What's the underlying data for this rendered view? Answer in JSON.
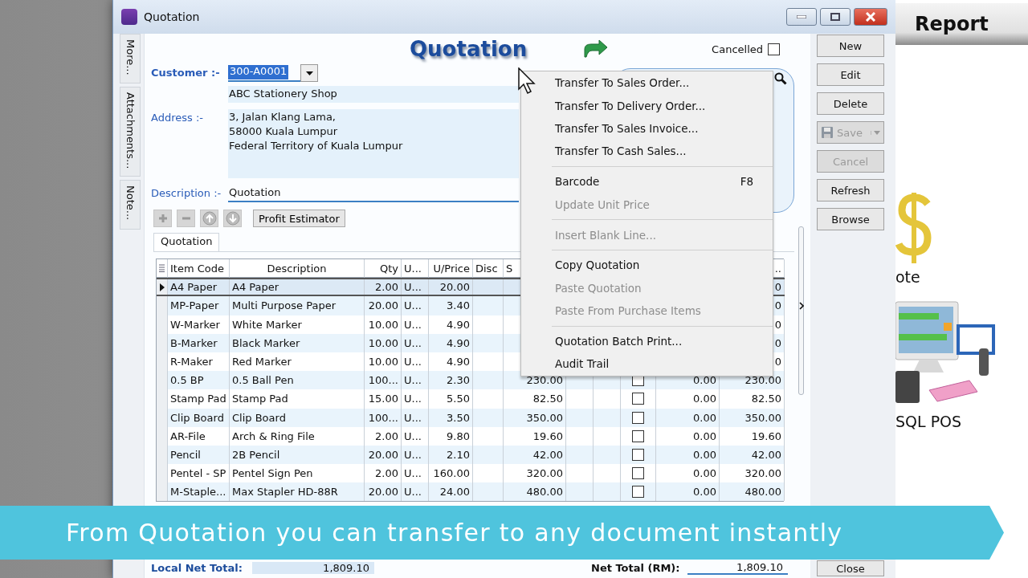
{
  "window": {
    "title": "Quotation"
  },
  "side_tabs": [
    {
      "label": "More..."
    },
    {
      "label": "Attachments..."
    },
    {
      "label": "Note..."
    }
  ],
  "header": {
    "title": "Quotation",
    "cancelled": {
      "label": "Cancelled",
      "checked": false
    }
  },
  "customer": {
    "label": "Customer :-",
    "code": "300-A0001",
    "name": "ABC Stationery Shop"
  },
  "address": {
    "label": "Address :-",
    "lines": [
      "3, Jalan Klang Lama,",
      "58000 Kuala Lumpur",
      "Federal Territory of Kuala Lumpur"
    ]
  },
  "description": {
    "label": "Description :-",
    "value": "Quotation"
  },
  "toolbar": {
    "icon_buttons": [
      {
        "kind": "add",
        "disabled": true
      },
      {
        "kind": "remove",
        "disabled": true
      },
      {
        "kind": "up",
        "disabled": true
      },
      {
        "kind": "down",
        "disabled": true
      }
    ],
    "button": "Profit Estimator"
  },
  "tabs": [
    {
      "label": "Quotation",
      "selected": true
    }
  ],
  "table": {
    "columns": [
      "Item Code",
      "Description",
      "Qty",
      "U...",
      "U/Price",
      "Disc",
      "S",
      ".."
    ],
    "rows": [
      {
        "selected": true,
        "item_code": "A4 Paper",
        "description": "A4 Paper",
        "qty": "2.00",
        "uom": "U...",
        "u_price": "20.00",
        "amount": "0"
      },
      {
        "selected": false,
        "item_code": "MP-Paper",
        "description": "Multi Purpose Paper",
        "qty": "20.00",
        "uom": "U...",
        "u_price": "3.40",
        "amount": "0"
      },
      {
        "selected": false,
        "item_code": "W-Marker",
        "description": "White Marker",
        "qty": "10.00",
        "uom": "U...",
        "u_price": "4.90",
        "amount": "0"
      },
      {
        "selected": false,
        "item_code": "B-Marker",
        "description": "Black Marker",
        "qty": "10.00",
        "uom": "U...",
        "u_price": "4.90",
        "amount": "0"
      },
      {
        "selected": false,
        "item_code": "R-Maker",
        "description": "Red Marker",
        "qty": "10.00",
        "uom": "U...",
        "u_price": "4.90",
        "amount": "0"
      },
      {
        "selected": false,
        "item_code": "0.5 BP",
        "description": "0.5 Ball Pen",
        "qty": "100...",
        "uom": "U...",
        "u_price": "2.30",
        "subtotal": "230.00",
        "checked": false,
        "discount": "0.00",
        "amount": "230.00"
      },
      {
        "selected": false,
        "item_code": "Stamp Pad",
        "description": "Stamp Pad",
        "qty": "15.00",
        "uom": "U...",
        "u_price": "5.50",
        "subtotal": "82.50",
        "checked": false,
        "discount": "0.00",
        "amount": "82.50"
      },
      {
        "selected": false,
        "item_code": "Clip Board",
        "description": "Clip Board",
        "qty": "100...",
        "uom": "U...",
        "u_price": "3.50",
        "subtotal": "350.00",
        "checked": false,
        "discount": "0.00",
        "amount": "350.00"
      },
      {
        "selected": false,
        "item_code": "AR-File",
        "description": "Arch & Ring File",
        "qty": "2.00",
        "uom": "U...",
        "u_price": "9.80",
        "subtotal": "19.60",
        "checked": false,
        "discount": "0.00",
        "amount": "19.60"
      },
      {
        "selected": false,
        "item_code": "Pencil",
        "description": "2B Pencil",
        "qty": "20.00",
        "uom": "U...",
        "u_price": "2.10",
        "subtotal": "42.00",
        "checked": false,
        "discount": "0.00",
        "amount": "42.00"
      },
      {
        "selected": false,
        "item_code": "Pentel - SP",
        "description": "Pentel Sign Pen",
        "qty": "2.00",
        "uom": "U...",
        "u_price": "160.00",
        "subtotal": "320.00",
        "checked": false,
        "discount": "0.00",
        "amount": "320.00"
      },
      {
        "selected": false,
        "item_code": "M-Staple...",
        "description": "Max Stapler HD-88R",
        "qty": "20.00",
        "uom": "U...",
        "u_price": "24.00",
        "subtotal": "480.00",
        "checked": false,
        "discount": "0.00",
        "amount": "480.00"
      }
    ]
  },
  "footer": {
    "local_net_total_label": "Local Net Total:",
    "local_net_total": "1,809.10",
    "net_total_label": "Net Total (RM):",
    "net_total": "1,809.10"
  },
  "buttons": [
    {
      "label": "New",
      "disabled": false,
      "kind": "plain"
    },
    {
      "label": "Edit",
      "disabled": false,
      "kind": "plain"
    },
    {
      "label": "Delete",
      "disabled": false,
      "kind": "plain"
    },
    {
      "label": "Save",
      "disabled": true,
      "kind": "split"
    },
    {
      "label": "Cancel",
      "disabled": true,
      "kind": "plain"
    },
    {
      "label": "Refresh",
      "disabled": false,
      "kind": "plain"
    },
    {
      "label": "Browse",
      "disabled": false,
      "kind": "plain"
    }
  ],
  "close_button": "Close",
  "context_menu": [
    {
      "kind": "item",
      "label": "Transfer To Sales Order...",
      "disabled": false
    },
    {
      "kind": "item",
      "label": "Transfer To Delivery Order...",
      "disabled": false
    },
    {
      "kind": "item",
      "label": "Transfer To Sales Invoice...",
      "disabled": false
    },
    {
      "kind": "item",
      "label": "Transfer To Cash Sales...",
      "disabled": false
    },
    {
      "kind": "separator"
    },
    {
      "kind": "item",
      "label": "Barcode",
      "disabled": false,
      "shortcut": "F8"
    },
    {
      "kind": "item",
      "label": "Update Unit Price",
      "disabled": true
    },
    {
      "kind": "separator"
    },
    {
      "kind": "item",
      "label": "Insert Blank Line...",
      "disabled": true
    },
    {
      "kind": "separator"
    },
    {
      "kind": "item",
      "label": "Copy Quotation",
      "disabled": false
    },
    {
      "kind": "item",
      "label": "Paste Quotation",
      "disabled": true
    },
    {
      "kind": "item",
      "label": "Paste From Purchase Items",
      "disabled": true
    },
    {
      "kind": "separator"
    },
    {
      "kind": "item",
      "label": "Quotation Batch Print...",
      "disabled": false
    },
    {
      "kind": "item",
      "label": "Audit Trail",
      "disabled": false
    }
  ],
  "right_panel": {
    "header": "Report",
    "labels": [
      "ote",
      "SQL POS"
    ]
  },
  "banner": {
    "text": "From Quotation you can transfer to any document instantly"
  }
}
